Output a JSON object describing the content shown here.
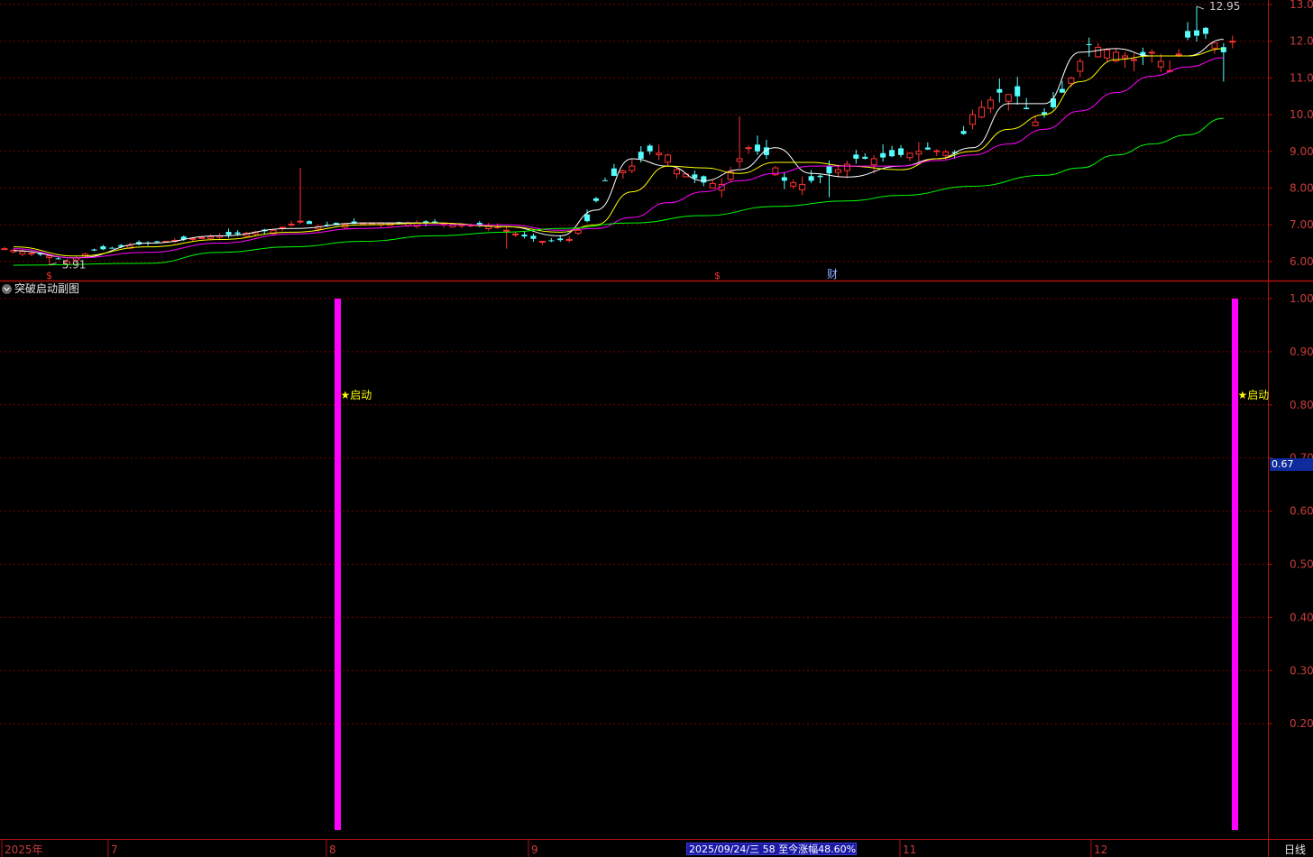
{
  "header": {
    "title_fragment": ""
  },
  "indicator": {
    "title": "突破启动副图"
  },
  "period_label": "日线",
  "status": "2025/09/24/三 58 至今涨幅48.60%",
  "current_value": "0.67",
  "colors": {
    "up": "#ff3232",
    "down": "#54ffff",
    "ma5": "#ffffff",
    "ma10": "#ffff00",
    "ma20": "#ff00ff",
    "ma60": "#00ff00",
    "signal": "#ff00ff",
    "grid": "#7a0000",
    "axis_text": "#c83c3c"
  },
  "chart_data": [
    {
      "type": "candlestick",
      "title": "",
      "ylim": [
        5.7,
        13.1
      ],
      "y_ticks": [
        "13.00",
        "12.00",
        "11.00",
        "10.00",
        "9.00",
        "8.00",
        "7.00",
        "6.00"
      ],
      "annotations": [
        {
          "text": "12.95",
          "kind": "high"
        },
        {
          "text": "5.91",
          "kind": "low"
        },
        {
          "text": "$",
          "kind": "marker"
        },
        {
          "text": "$",
          "kind": "marker"
        },
        {
          "text": "财",
          "kind": "marker"
        }
      ],
      "series": [
        {
          "name": "",
          "kind": "ma",
          "points": [
            [
              1,
              6.3
            ],
            [
              8,
              6.1
            ],
            [
              16,
              6.5
            ],
            [
              24,
              6.7
            ],
            [
              32,
              6.9
            ],
            [
              40,
              7.05
            ],
            [
              48,
              7.05
            ],
            [
              56,
              6.95
            ],
            [
              62,
              6.7
            ],
            [
              66,
              7.4
            ],
            [
              70,
              8.8
            ],
            [
              74,
              8.6
            ],
            [
              78,
              8.2
            ],
            [
              82,
              8.5
            ],
            [
              86,
              9.1
            ],
            [
              90,
              8.4
            ],
            [
              94,
              8.3
            ],
            [
              100,
              8.6
            ],
            [
              104,
              8.8
            ],
            [
              108,
              9.1
            ],
            [
              112,
              10.3
            ],
            [
              116,
              10.3
            ],
            [
              120,
              11.7
            ],
            [
              124,
              11.8
            ],
            [
              128,
              11.6
            ],
            [
              132,
              11.6
            ],
            [
              136,
              12.05
            ]
          ]
        },
        {
          "name": "",
          "kind": "ma",
          "points": [
            [
              1,
              6.4
            ],
            [
              8,
              6.15
            ],
            [
              16,
              6.4
            ],
            [
              24,
              6.6
            ],
            [
              32,
              6.8
            ],
            [
              40,
              7.0
            ],
            [
              48,
              7.05
            ],
            [
              56,
              6.95
            ],
            [
              62,
              6.8
            ],
            [
              66,
              7.0
            ],
            [
              70,
              7.9
            ],
            [
              74,
              8.6
            ],
            [
              78,
              8.55
            ],
            [
              82,
              8.4
            ],
            [
              86,
              8.7
            ],
            [
              90,
              8.7
            ],
            [
              94,
              8.6
            ],
            [
              100,
              8.5
            ],
            [
              104,
              8.8
            ],
            [
              108,
              9.0
            ],
            [
              112,
              9.6
            ],
            [
              116,
              10.0
            ],
            [
              120,
              10.9
            ],
            [
              124,
              11.5
            ],
            [
              128,
              11.6
            ],
            [
              132,
              11.6
            ],
            [
              136,
              11.8
            ]
          ]
        },
        {
          "name": "",
          "kind": "ma",
          "points": [
            [
              1,
              6.35
            ],
            [
              8,
              6.1
            ],
            [
              16,
              6.25
            ],
            [
              24,
              6.5
            ],
            [
              32,
              6.75
            ],
            [
              40,
              6.9
            ],
            [
              48,
              7.0
            ],
            [
              56,
              7.0
            ],
            [
              62,
              6.85
            ],
            [
              66,
              6.9
            ],
            [
              70,
              7.2
            ],
            [
              74,
              7.6
            ],
            [
              78,
              7.9
            ],
            [
              82,
              8.2
            ],
            [
              86,
              8.4
            ],
            [
              90,
              8.6
            ],
            [
              94,
              8.6
            ],
            [
              100,
              8.6
            ],
            [
              104,
              8.75
            ],
            [
              108,
              8.9
            ],
            [
              112,
              9.2
            ],
            [
              116,
              9.6
            ],
            [
              120,
              10.1
            ],
            [
              124,
              10.6
            ],
            [
              128,
              11.05
            ],
            [
              132,
              11.3
            ],
            [
              136,
              11.55
            ]
          ]
        },
        {
          "name": "",
          "kind": "ma",
          "points": [
            [
              1,
              5.9
            ],
            [
              16,
              5.95
            ],
            [
              24,
              6.25
            ],
            [
              32,
              6.4
            ],
            [
              40,
              6.55
            ],
            [
              48,
              6.7
            ],
            [
              56,
              6.8
            ],
            [
              62,
              6.9
            ],
            [
              70,
              7.05
            ],
            [
              78,
              7.25
            ],
            [
              86,
              7.5
            ],
            [
              94,
              7.65
            ],
            [
              100,
              7.8
            ],
            [
              108,
              8.05
            ],
            [
              116,
              8.35
            ],
            [
              120,
              8.55
            ],
            [
              124,
              8.9
            ],
            [
              128,
              9.2
            ],
            [
              132,
              9.45
            ],
            [
              136,
              9.9
            ]
          ]
        }
      ]
    },
    {
      "type": "bar",
      "title": "突破启动副图",
      "ylim": [
        0,
        1.0
      ],
      "y_ticks": [
        "1.00",
        "0.90",
        "0.80",
        "0.70",
        "0.60",
        "0.50",
        "0.40",
        "0.30",
        "0.20"
      ],
      "x_ticks": [
        "2025年",
        "7",
        "8",
        "9",
        "11",
        "12"
      ],
      "series": [
        {
          "name": "",
          "values": [
            1,
            1
          ]
        }
      ],
      "labels": [
        "★启动",
        "★启动"
      ]
    }
  ]
}
